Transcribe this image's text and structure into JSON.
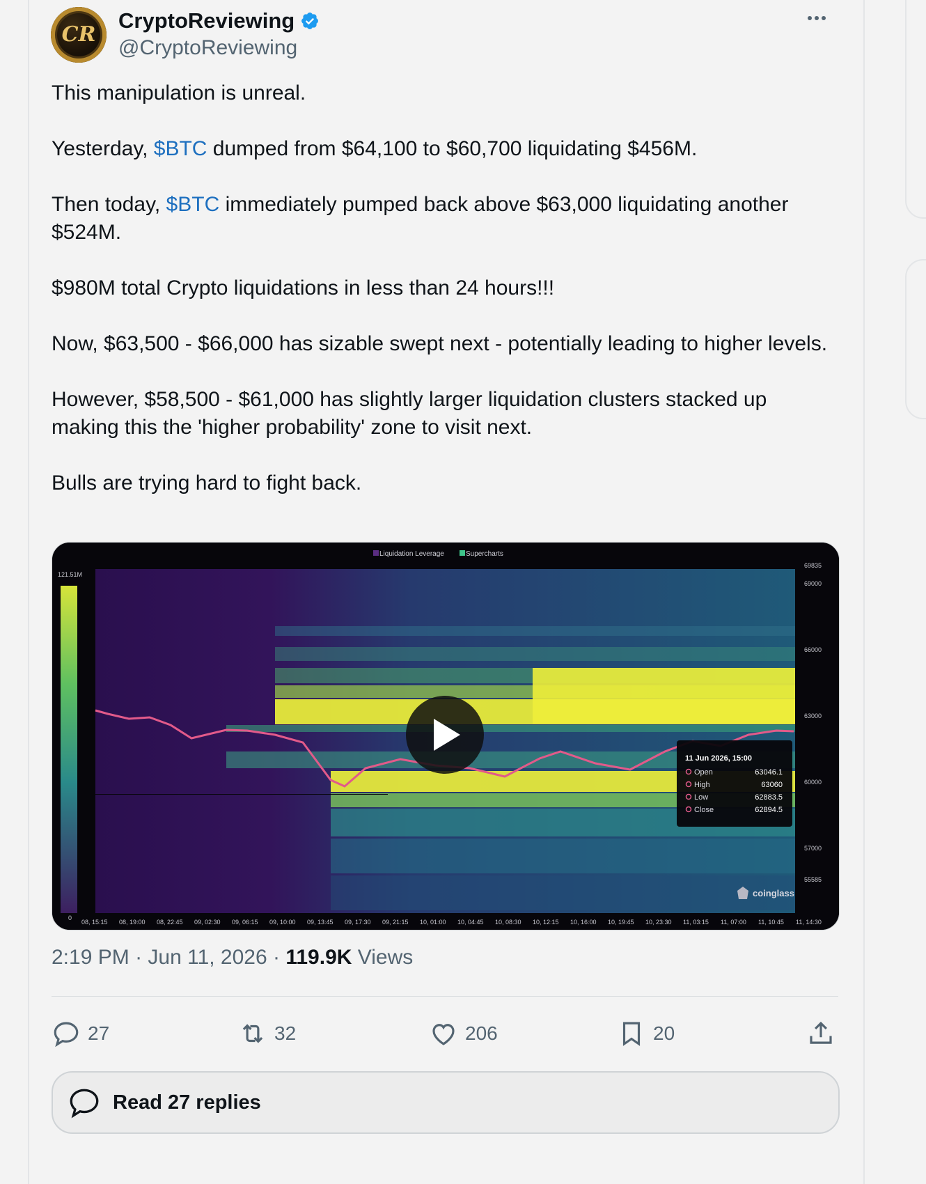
{
  "author": {
    "name": "CryptoReviewing",
    "handle": "@CryptoReviewing",
    "verified": true,
    "avatar_monogram": "CR"
  },
  "tweet": {
    "line1": "This manipulation is unreal.",
    "line2_a": "Yesterday, ",
    "line2_cash": "$BTC",
    "line2_b": " dumped from $64,100 to $60,700 liquidating $456M.",
    "line3_a": "Then today, ",
    "line3_cash": "$BTC",
    "line3_b": " immediately pumped back above $63,000 liquidating another $524M.",
    "line4": "$980M total Crypto liquidations in less than 24 hours!!!",
    "line5": "Now, $63,500 - $66,000 has sizable  swept next - potentially leading to higher levels.",
    "line6": "However, $58,500 - $61,000 has slightly larger liquidation clusters stacked up making this the 'higher probability' zone to visit next.",
    "line7": "Bulls are trying hard to fight back."
  },
  "media": {
    "type": "video",
    "legend": [
      "Liquidation Leverage",
      "Supercharts"
    ],
    "scale_max": "121.51M",
    "scale_min": "0",
    "y_ticks": [
      "69835",
      "69000",
      "66000",
      "63000",
      "60000",
      "57000",
      "55585"
    ],
    "x_ticks": [
      "08, 15:15",
      "08, 19:00",
      "08, 22:45",
      "09, 02:30",
      "09, 06:15",
      "09, 10:00",
      "09, 13:45",
      "09, 17:30",
      "09, 21:15",
      "10, 01:00",
      "10, 04:45",
      "10, 08:30",
      "10, 12:15",
      "10, 16:00",
      "10, 19:45",
      "10, 23:30",
      "11, 03:15",
      "11, 07:00",
      "11, 10:45",
      "11, 14:30"
    ],
    "tooltip": {
      "title": "11 Jun 2026, 15:00",
      "rows": [
        {
          "label": "Open",
          "value": "63046.1"
        },
        {
          "label": "High",
          "value": "63060"
        },
        {
          "label": "Low",
          "value": "62883.5"
        },
        {
          "label": "Close",
          "value": "62894.5"
        }
      ]
    },
    "watermark": "coinglass"
  },
  "meta": {
    "time": "2:19 PM",
    "date": "Jun 11, 2026",
    "views_count": "119.9K",
    "views_label": " Views"
  },
  "actions": {
    "replies": "27",
    "reposts": "32",
    "likes": "206",
    "bookmarks": "20"
  },
  "read_replies": "Read 27 replies",
  "colors": {
    "cashtag": "#1d6fbf",
    "verified": "#1d9bf0",
    "muted": "#536471"
  }
}
